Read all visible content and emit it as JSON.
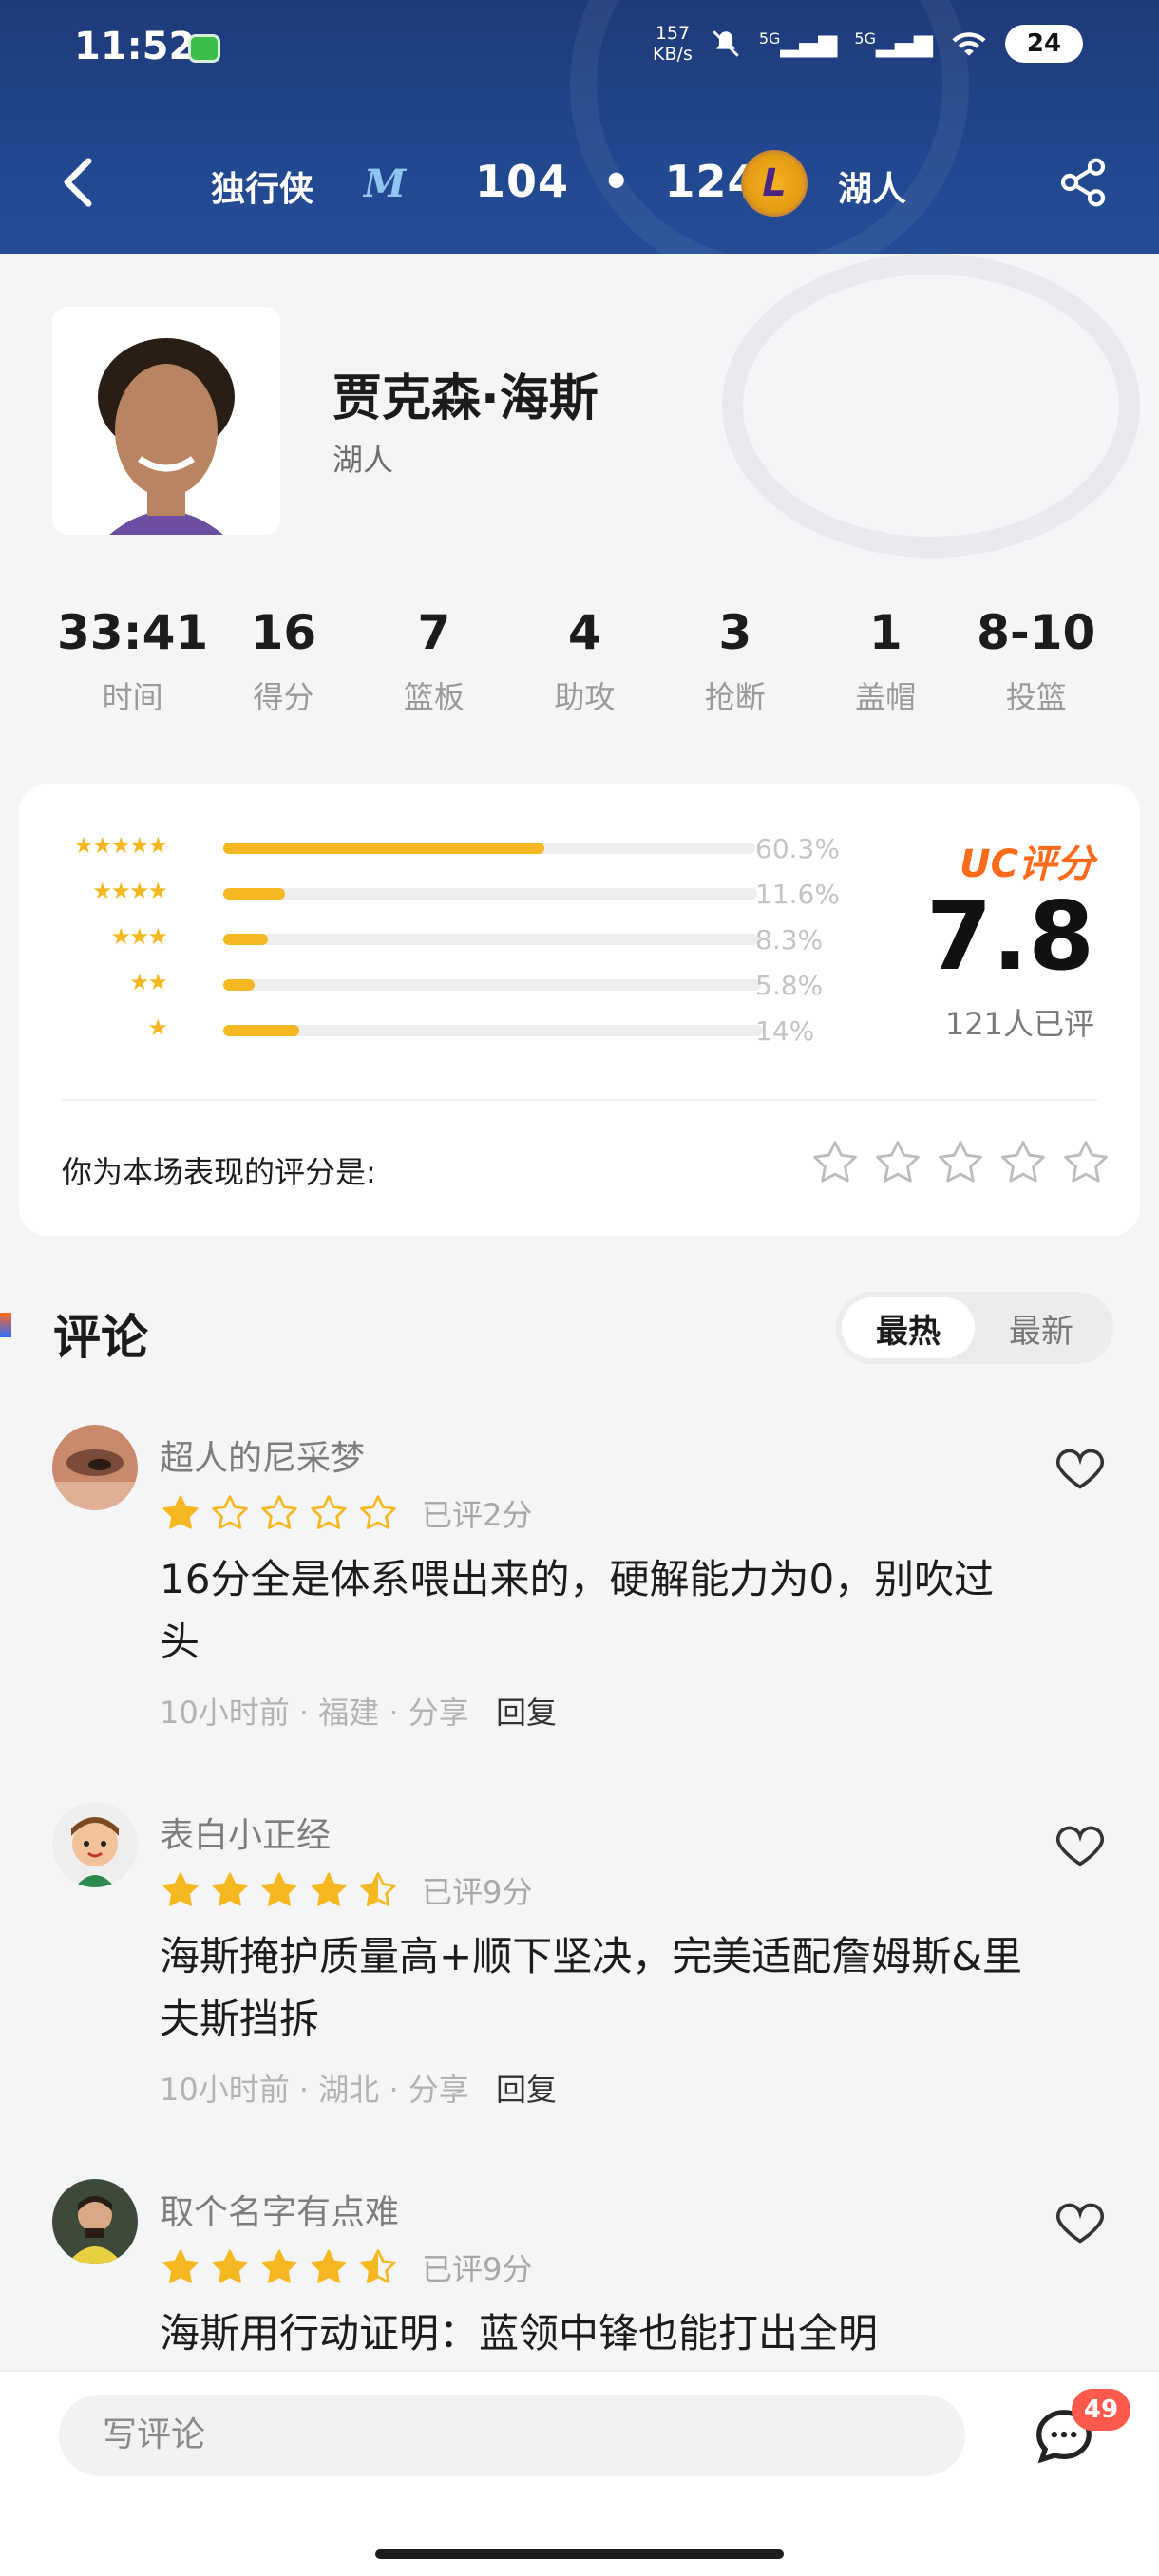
{
  "status_bar": {
    "time": "11:52",
    "net_speed_value": "157",
    "net_speed_unit": "KB/s",
    "sig1": "5G",
    "sig2": "5G",
    "battery": "24"
  },
  "header": {
    "team_left": "独行侠",
    "score_left": "104",
    "score_sep": "•",
    "score_right": "124",
    "team_right": "湖人",
    "back_icon": "chevron-left-icon",
    "share_icon": "share-icon"
  },
  "player": {
    "name": "贾克森·海斯",
    "team": "湖人"
  },
  "stats": [
    {
      "value": "33:41",
      "label": "时间"
    },
    {
      "value": "16",
      "label": "得分"
    },
    {
      "value": "7",
      "label": "篮板"
    },
    {
      "value": "4",
      "label": "助攻"
    },
    {
      "value": "3",
      "label": "抢断"
    },
    {
      "value": "1",
      "label": "盖帽"
    },
    {
      "value": "8-10",
      "label": "投篮"
    }
  ],
  "rating": {
    "distribution": [
      {
        "stars": 5,
        "percent": 60.3,
        "label": "60.3%"
      },
      {
        "stars": 4,
        "percent": 11.6,
        "label": "11.6%"
      },
      {
        "stars": 3,
        "percent": 8.3,
        "label": "8.3%"
      },
      {
        "stars": 2,
        "percent": 5.8,
        "label": "5.8%"
      },
      {
        "stars": 1,
        "percent": 14,
        "label": "14%"
      }
    ],
    "uc_label": "UC评分",
    "score": "7.8",
    "count": "121人已评",
    "your_prompt": "你为本场表现的评分是:"
  },
  "comments": {
    "title": "评论",
    "sort_hot": "最热",
    "sort_new": "最新",
    "items": [
      {
        "user": "超人的尼采梦",
        "stars": 1,
        "rated": "已评2分",
        "text": "16分全是体系喂出来的，硬解能力为0，别吹过头",
        "time": "10小时前",
        "location": "福建",
        "share": "分享",
        "reply": "回复"
      },
      {
        "user": "表白小正经",
        "stars": 4.5,
        "rated": "已评9分",
        "text": "海斯掩护质量高+顺下坚决，完美适配詹姆斯&里夫斯挡拆",
        "time": "10小时前",
        "location": "湖北",
        "share": "分享",
        "reply": "回复"
      },
      {
        "user": "取个名字有点难",
        "stars": 4.5,
        "rated": "已评9分",
        "text": "海斯用行动证明：蓝领中锋也能打出全明"
      }
    ]
  },
  "bottom": {
    "write_placeholder": "写评论",
    "badge_count": "49"
  },
  "colors": {
    "header_bg": "#22478e",
    "star_gold": "#f5b820",
    "uc_orange": "#ff6b1a",
    "badge_red": "#ff5a4c"
  }
}
